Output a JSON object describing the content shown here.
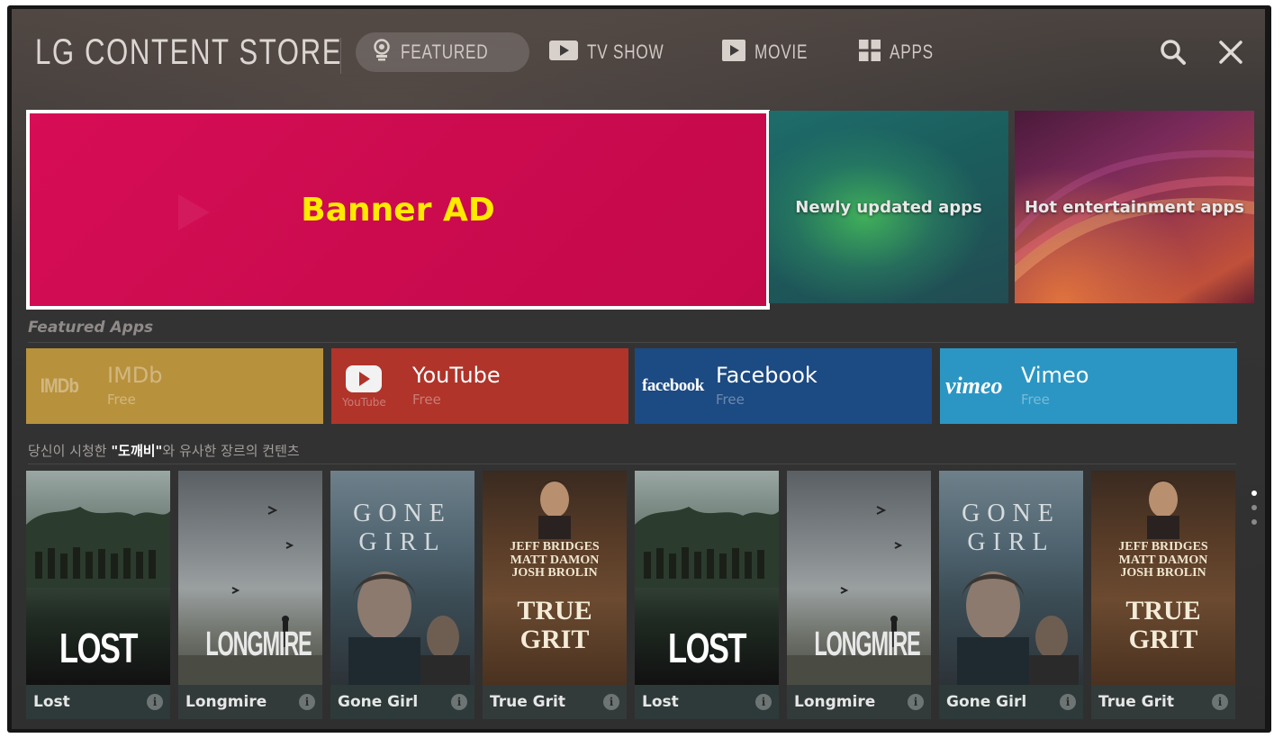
{
  "header": {
    "title": "LG CONTENT STORE",
    "tabs": [
      {
        "label": "FEATURED",
        "icon": "featured-badge-icon",
        "active": true
      },
      {
        "label": "TV SHOW",
        "icon": "tv-play-icon",
        "active": false
      },
      {
        "label": "MOVIE",
        "icon": "movie-play-icon",
        "active": false
      },
      {
        "label": "APPS",
        "icon": "apps-grid-icon",
        "active": false
      }
    ],
    "search_icon": "search-icon",
    "close_icon": "close-icon"
  },
  "banners": {
    "ad_label": "Banner AD",
    "tiles": [
      {
        "label": "Newly updated apps"
      },
      {
        "label": "Hot entertainment apps"
      }
    ]
  },
  "featured_apps": {
    "section_title": "Featured Apps",
    "apps": [
      {
        "name": "IMDb",
        "price": "Free",
        "logo": "IMDb",
        "color": "#b8913c"
      },
      {
        "name": "YouTube",
        "price": "Free",
        "logo": "YouTube",
        "color": "#b0342a"
      },
      {
        "name": "Facebook",
        "price": "Free",
        "logo": "facebook",
        "color": "#1c4a83"
      },
      {
        "name": "Vimeo",
        "price": "Free",
        "logo": "vimeo",
        "color": "#2b96c4"
      }
    ]
  },
  "recommendations": {
    "title_prefix": "당신이 시청한 ",
    "title_highlight": "\"도깨비\"",
    "title_suffix": "와 유사한 장르의 컨텐츠",
    "items": [
      {
        "title": "Lost",
        "poster_text": "LOST"
      },
      {
        "title": "Longmire",
        "poster_text": "LONGMIRE"
      },
      {
        "title": "Gone Girl",
        "poster_text": "GONE GIRL"
      },
      {
        "title": "True Grit",
        "poster_text": "TRUE GRIT",
        "cast": [
          "JEFF BRIDGES",
          "MATT DAMON",
          "JOSH BROLIN"
        ]
      },
      {
        "title": "Lost",
        "poster_text": "LOST"
      },
      {
        "title": "Longmire",
        "poster_text": "LONGMIRE"
      },
      {
        "title": "Gone Girl",
        "poster_text": "GONE GIRL"
      },
      {
        "title": "True Grit",
        "poster_text": "TRUE GRIT",
        "cast": [
          "JEFF BRIDGES",
          "MATT DAMON",
          "JOSH BROLIN"
        ]
      }
    ]
  },
  "colors": {
    "banner_ad": "#d70d55",
    "banner_ad_text": "#ffea00",
    "focus_border": "#ffffff"
  }
}
